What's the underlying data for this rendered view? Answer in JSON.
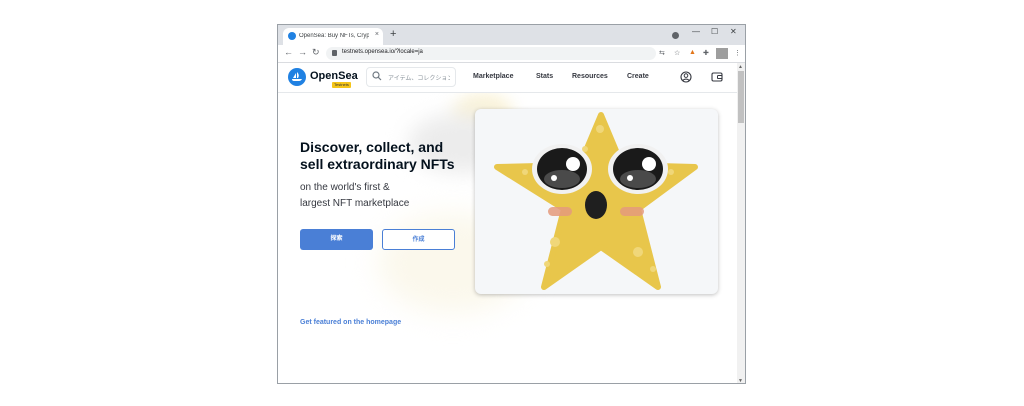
{
  "browser": {
    "tab_title": "OpenSea: Buy NFTs, Crypto Colle",
    "tab_close": "×",
    "new_tab": "+",
    "url": "testnets.opensea.io/?locale=ja",
    "window_controls": {
      "minimize": "—",
      "maximize": "☐",
      "close": "✕"
    }
  },
  "header": {
    "brand": "OpenSea",
    "badge": "Testnets",
    "search_placeholder": "アイテム、コレクション",
    "menu": [
      "Marketplace",
      "Stats",
      "Resources",
      "Create"
    ]
  },
  "hero": {
    "title_line1": "Discover, collect, and",
    "title_line2": "sell extraordinary NFTs",
    "subtitle_line1": "on the world's first &",
    "subtitle_line2": "largest NFT marketplace",
    "explore_label": "探索",
    "create_label": "作成",
    "featured_link": "Get featured on the homepage"
  },
  "colors": {
    "accent": "#2081e2",
    "button": "#4a7fd6",
    "star": "#e8c64b"
  },
  "icons": [
    "opensea-logo-icon",
    "search-icon",
    "profile-icon",
    "wallet-icon",
    "lock-icon"
  ]
}
